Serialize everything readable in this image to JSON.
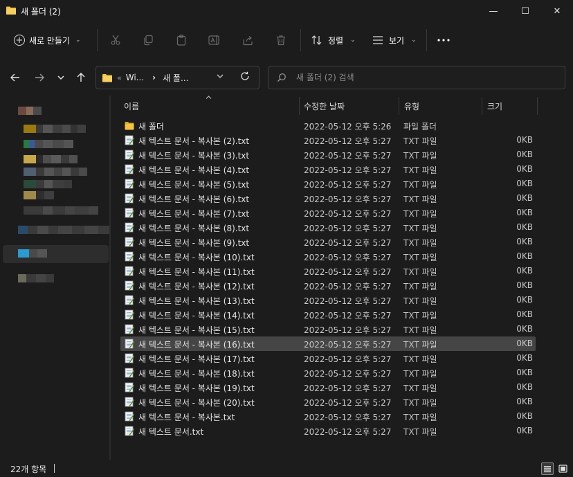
{
  "window": {
    "title": "새 폴더 (2)",
    "minimize_glyph": "—",
    "maximize_glyph": "☐",
    "close_glyph": "✕"
  },
  "commandbar": {
    "new_label": "새로 만들기",
    "sort_label": "정렬",
    "view_label": "보기",
    "more_glyph": "•••"
  },
  "address": {
    "overflow": "«",
    "segment1": "Wi...",
    "separator": "›",
    "segment2": "새 폴...",
    "search_placeholder": "새 폴더 (2) 검색"
  },
  "columns": {
    "name": "이름",
    "date": "수정한 날짜",
    "type": "유형",
    "size": "크기"
  },
  "files": [
    {
      "name": "새 폴더",
      "date": "2022-05-12 오후 5:26",
      "type": "파일 폴더",
      "size": "",
      "icon": "folder-icon"
    },
    {
      "name": "새 텍스트 문서 - 복사본 (2).txt",
      "date": "2022-05-12 오후 5:27",
      "type": "TXT 파일",
      "size": "0KB",
      "icon": "text-file-icon"
    },
    {
      "name": "새 텍스트 문서 - 복사본 (3).txt",
      "date": "2022-05-12 오후 5:27",
      "type": "TXT 파일",
      "size": "0KB",
      "icon": "text-file-icon"
    },
    {
      "name": "새 텍스트 문서 - 복사본 (4).txt",
      "date": "2022-05-12 오후 5:27",
      "type": "TXT 파일",
      "size": "0KB",
      "icon": "text-file-icon"
    },
    {
      "name": "새 텍스트 문서 - 복사본 (5).txt",
      "date": "2022-05-12 오후 5:27",
      "type": "TXT 파일",
      "size": "0KB",
      "icon": "text-file-icon"
    },
    {
      "name": "새 텍스트 문서 - 복사본 (6).txt",
      "date": "2022-05-12 오후 5:27",
      "type": "TXT 파일",
      "size": "0KB",
      "icon": "text-file-icon"
    },
    {
      "name": "새 텍스트 문서 - 복사본 (7).txt",
      "date": "2022-05-12 오후 5:27",
      "type": "TXT 파일",
      "size": "0KB",
      "icon": "text-file-icon"
    },
    {
      "name": "새 텍스트 문서 - 복사본 (8).txt",
      "date": "2022-05-12 오후 5:27",
      "type": "TXT 파일",
      "size": "0KB",
      "icon": "text-file-icon"
    },
    {
      "name": "새 텍스트 문서 - 복사본 (9).txt",
      "date": "2022-05-12 오후 5:27",
      "type": "TXT 파일",
      "size": "0KB",
      "icon": "text-file-icon"
    },
    {
      "name": "새 텍스트 문서 - 복사본 (10).txt",
      "date": "2022-05-12 오후 5:27",
      "type": "TXT 파일",
      "size": "0KB",
      "icon": "text-file-icon"
    },
    {
      "name": "새 텍스트 문서 - 복사본 (11).txt",
      "date": "2022-05-12 오후 5:27",
      "type": "TXT 파일",
      "size": "0KB",
      "icon": "text-file-icon"
    },
    {
      "name": "새 텍스트 문서 - 복사본 (12).txt",
      "date": "2022-05-12 오후 5:27",
      "type": "TXT 파일",
      "size": "0KB",
      "icon": "text-file-icon"
    },
    {
      "name": "새 텍스트 문서 - 복사본 (13).txt",
      "date": "2022-05-12 오후 5:27",
      "type": "TXT 파일",
      "size": "0KB",
      "icon": "text-file-icon"
    },
    {
      "name": "새 텍스트 문서 - 복사본 (14).txt",
      "date": "2022-05-12 오후 5:27",
      "type": "TXT 파일",
      "size": "0KB",
      "icon": "text-file-icon"
    },
    {
      "name": "새 텍스트 문서 - 복사본 (15).txt",
      "date": "2022-05-12 오후 5:27",
      "type": "TXT 파일",
      "size": "0KB",
      "icon": "text-file-icon"
    },
    {
      "name": "새 텍스트 문서 - 복사본 (16).txt",
      "date": "2022-05-12 오후 5:27",
      "type": "TXT 파일",
      "size": "0KB",
      "icon": "text-file-icon",
      "selected": true
    },
    {
      "name": "새 텍스트 문서 - 복사본 (17).txt",
      "date": "2022-05-12 오후 5:27",
      "type": "TXT 파일",
      "size": "0KB",
      "icon": "text-file-icon"
    },
    {
      "name": "새 텍스트 문서 - 복사본 (18).txt",
      "date": "2022-05-12 오후 5:27",
      "type": "TXT 파일",
      "size": "0KB",
      "icon": "text-file-icon"
    },
    {
      "name": "새 텍스트 문서 - 복사본 (19).txt",
      "date": "2022-05-12 오후 5:27",
      "type": "TXT 파일",
      "size": "0KB",
      "icon": "text-file-icon"
    },
    {
      "name": "새 텍스트 문서 - 복사본 (20).txt",
      "date": "2022-05-12 오후 5:27",
      "type": "TXT 파일",
      "size": "0KB",
      "icon": "text-file-icon"
    },
    {
      "name": "새 텍스트 문서 - 복사본.txt",
      "date": "2022-05-12 오후 5:27",
      "type": "TXT 파일",
      "size": "0KB",
      "icon": "text-file-icon"
    },
    {
      "name": "새 텍스트 문서.txt",
      "date": "2022-05-12 오후 5:27",
      "type": "TXT 파일",
      "size": "0KB",
      "icon": "text-file-icon"
    }
  ],
  "status": {
    "item_count": "22개 항목"
  },
  "colors": {
    "background": "#1c1c1c",
    "selection": "#454545",
    "folder": "#f5c342",
    "text": "#e6e6e6"
  }
}
